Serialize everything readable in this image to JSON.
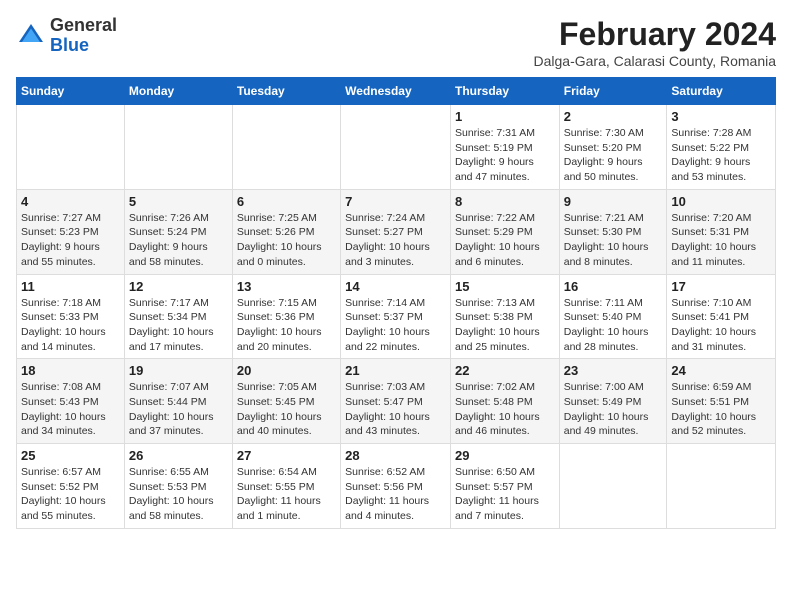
{
  "header": {
    "logo_line1": "General",
    "logo_line2": "Blue",
    "month": "February 2024",
    "location": "Dalga-Gara, Calarasi County, Romania"
  },
  "days_of_week": [
    "Sunday",
    "Monday",
    "Tuesday",
    "Wednesday",
    "Thursday",
    "Friday",
    "Saturday"
  ],
  "weeks": [
    [
      {
        "day": "",
        "content": ""
      },
      {
        "day": "",
        "content": ""
      },
      {
        "day": "",
        "content": ""
      },
      {
        "day": "",
        "content": ""
      },
      {
        "day": "1",
        "content": "Sunrise: 7:31 AM\nSunset: 5:19 PM\nDaylight: 9 hours\nand 47 minutes."
      },
      {
        "day": "2",
        "content": "Sunrise: 7:30 AM\nSunset: 5:20 PM\nDaylight: 9 hours\nand 50 minutes."
      },
      {
        "day": "3",
        "content": "Sunrise: 7:28 AM\nSunset: 5:22 PM\nDaylight: 9 hours\nand 53 minutes."
      }
    ],
    [
      {
        "day": "4",
        "content": "Sunrise: 7:27 AM\nSunset: 5:23 PM\nDaylight: 9 hours\nand 55 minutes."
      },
      {
        "day": "5",
        "content": "Sunrise: 7:26 AM\nSunset: 5:24 PM\nDaylight: 9 hours\nand 58 minutes."
      },
      {
        "day": "6",
        "content": "Sunrise: 7:25 AM\nSunset: 5:26 PM\nDaylight: 10 hours\nand 0 minutes."
      },
      {
        "day": "7",
        "content": "Sunrise: 7:24 AM\nSunset: 5:27 PM\nDaylight: 10 hours\nand 3 minutes."
      },
      {
        "day": "8",
        "content": "Sunrise: 7:22 AM\nSunset: 5:29 PM\nDaylight: 10 hours\nand 6 minutes."
      },
      {
        "day": "9",
        "content": "Sunrise: 7:21 AM\nSunset: 5:30 PM\nDaylight: 10 hours\nand 8 minutes."
      },
      {
        "day": "10",
        "content": "Sunrise: 7:20 AM\nSunset: 5:31 PM\nDaylight: 10 hours\nand 11 minutes."
      }
    ],
    [
      {
        "day": "11",
        "content": "Sunrise: 7:18 AM\nSunset: 5:33 PM\nDaylight: 10 hours\nand 14 minutes."
      },
      {
        "day": "12",
        "content": "Sunrise: 7:17 AM\nSunset: 5:34 PM\nDaylight: 10 hours\nand 17 minutes."
      },
      {
        "day": "13",
        "content": "Sunrise: 7:15 AM\nSunset: 5:36 PM\nDaylight: 10 hours\nand 20 minutes."
      },
      {
        "day": "14",
        "content": "Sunrise: 7:14 AM\nSunset: 5:37 PM\nDaylight: 10 hours\nand 22 minutes."
      },
      {
        "day": "15",
        "content": "Sunrise: 7:13 AM\nSunset: 5:38 PM\nDaylight: 10 hours\nand 25 minutes."
      },
      {
        "day": "16",
        "content": "Sunrise: 7:11 AM\nSunset: 5:40 PM\nDaylight: 10 hours\nand 28 minutes."
      },
      {
        "day": "17",
        "content": "Sunrise: 7:10 AM\nSunset: 5:41 PM\nDaylight: 10 hours\nand 31 minutes."
      }
    ],
    [
      {
        "day": "18",
        "content": "Sunrise: 7:08 AM\nSunset: 5:43 PM\nDaylight: 10 hours\nand 34 minutes."
      },
      {
        "day": "19",
        "content": "Sunrise: 7:07 AM\nSunset: 5:44 PM\nDaylight: 10 hours\nand 37 minutes."
      },
      {
        "day": "20",
        "content": "Sunrise: 7:05 AM\nSunset: 5:45 PM\nDaylight: 10 hours\nand 40 minutes."
      },
      {
        "day": "21",
        "content": "Sunrise: 7:03 AM\nSunset: 5:47 PM\nDaylight: 10 hours\nand 43 minutes."
      },
      {
        "day": "22",
        "content": "Sunrise: 7:02 AM\nSunset: 5:48 PM\nDaylight: 10 hours\nand 46 minutes."
      },
      {
        "day": "23",
        "content": "Sunrise: 7:00 AM\nSunset: 5:49 PM\nDaylight: 10 hours\nand 49 minutes."
      },
      {
        "day": "24",
        "content": "Sunrise: 6:59 AM\nSunset: 5:51 PM\nDaylight: 10 hours\nand 52 minutes."
      }
    ],
    [
      {
        "day": "25",
        "content": "Sunrise: 6:57 AM\nSunset: 5:52 PM\nDaylight: 10 hours\nand 55 minutes."
      },
      {
        "day": "26",
        "content": "Sunrise: 6:55 AM\nSunset: 5:53 PM\nDaylight: 10 hours\nand 58 minutes."
      },
      {
        "day": "27",
        "content": "Sunrise: 6:54 AM\nSunset: 5:55 PM\nDaylight: 11 hours\nand 1 minute."
      },
      {
        "day": "28",
        "content": "Sunrise: 6:52 AM\nSunset: 5:56 PM\nDaylight: 11 hours\nand 4 minutes."
      },
      {
        "day": "29",
        "content": "Sunrise: 6:50 AM\nSunset: 5:57 PM\nDaylight: 11 hours\nand 7 minutes."
      },
      {
        "day": "",
        "content": ""
      },
      {
        "day": "",
        "content": ""
      }
    ]
  ]
}
